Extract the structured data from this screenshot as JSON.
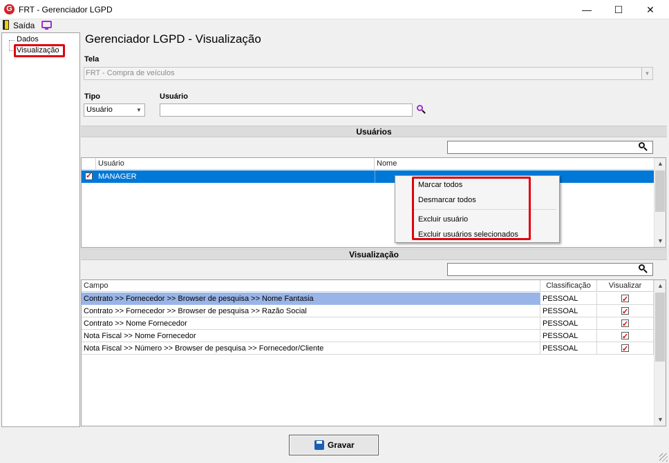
{
  "window": {
    "title": "FRT - Gerenciador LGPD",
    "logo_letter": "G",
    "minimize": "—",
    "maximize": "☐",
    "close": "✕"
  },
  "menu": {
    "exit_label": "Saída"
  },
  "sidebar": {
    "items": [
      {
        "label": "Dados"
      },
      {
        "label": "Visualização"
      }
    ]
  },
  "page_title": "Gerenciador LGPD - Visualização",
  "tela": {
    "label": "Tela",
    "value": "FRT - Compra de veículos"
  },
  "tipo": {
    "label": "Tipo",
    "value": "Usuário"
  },
  "usuario": {
    "label": "Usuário",
    "value": ""
  },
  "users_section": {
    "title": "Usuários",
    "search_value": "",
    "columns": [
      "Usuário",
      "Nome"
    ],
    "rows": [
      {
        "checked": true,
        "usuario": "MANAGER",
        "nome": ""
      }
    ]
  },
  "context_menu": {
    "items": [
      "Marcar todos",
      "Desmarcar todos",
      "Excluir usuário",
      "Excluir usuários selecionados"
    ]
  },
  "view_section": {
    "title": "Visualização",
    "search_value": "",
    "columns": [
      "Campo",
      "Classificação",
      "Visualizar"
    ],
    "rows": [
      {
        "campo": "Contrato >> Fornecedor >> Browser de pesquisa >> Nome Fantasia",
        "classificacao": "PESSOAL",
        "visualizar": true
      },
      {
        "campo": "Contrato >> Fornecedor >> Browser de pesquisa >> Razão Social",
        "classificacao": "PESSOAL",
        "visualizar": true
      },
      {
        "campo": "Contrato >> Nome Fornecedor",
        "classificacao": "PESSOAL",
        "visualizar": true
      },
      {
        "campo": "Nota Fiscal  >> Nome Fornecedor",
        "classificacao": "PESSOAL",
        "visualizar": true
      },
      {
        "campo": "Nota Fiscal >> Número  >> Browser de pesquisa >> Fornecedor/Cliente",
        "classificacao": "PESSOAL",
        "visualizar": true
      }
    ]
  },
  "footer": {
    "save_label": "Gravar"
  },
  "colors": {
    "selection": "#0078d7",
    "selection_light": "#99b4e6",
    "highlight": "#e0000b",
    "accent_purple": "#9b2fd1"
  }
}
